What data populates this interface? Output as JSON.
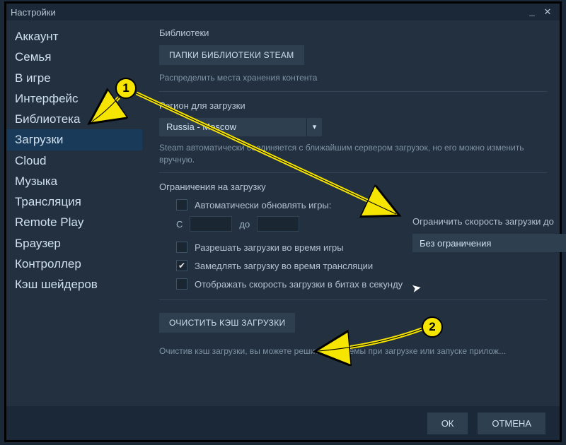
{
  "window": {
    "title": "Настройки"
  },
  "sidebar": {
    "items": [
      {
        "label": "Аккаунт"
      },
      {
        "label": "Семья"
      },
      {
        "label": "В игре"
      },
      {
        "label": "Интерфейс"
      },
      {
        "label": "Библиотека"
      },
      {
        "label": "Загрузки"
      },
      {
        "label": "Cloud"
      },
      {
        "label": "Музыка"
      },
      {
        "label": "Трансляция"
      },
      {
        "label": "Remote Play"
      },
      {
        "label": "Браузер"
      },
      {
        "label": "Контроллер"
      },
      {
        "label": "Кэш шейдеров"
      }
    ],
    "active_index": 5
  },
  "libraries": {
    "title": "Библиотеки",
    "button": "ПАПКИ БИБЛИОТЕКИ STEAM",
    "helper": "Распределить места хранения контента"
  },
  "region": {
    "title": "Регион для загрузки",
    "selected": "Russia - Moscow",
    "helper": "Steam автоматически соединяется с ближайшим сервером загрузок, но его можно изменить вручную."
  },
  "limits": {
    "title": "Ограничения на загрузку",
    "auto_update_label": "Автоматически обновлять игры:",
    "from_label": "С",
    "to_label": "до",
    "restrict_label": "Ограничить скорость загрузки до",
    "restrict_value": "Без ограничения",
    "cb_allow_during_play": "Разрешать загрузки во время игры",
    "cb_throttle_stream": "Замедлять загрузку во время трансляции",
    "cb_show_bits": "Отображать скорость загрузки в битах в секунду"
  },
  "cache": {
    "button": "ОЧИСТИТЬ КЭШ ЗАГРУЗКИ",
    "helper": "Очистив кэш загрузки, вы можете решить проблемы при загрузке или запуске прилож..."
  },
  "footer": {
    "ok": "ОК",
    "cancel": "ОТМЕНА"
  },
  "annotations": {
    "badge1": "1",
    "badge2": "2"
  }
}
